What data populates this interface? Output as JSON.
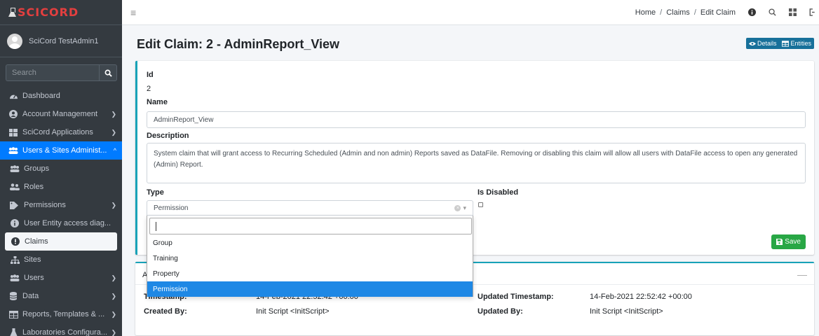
{
  "brand": {
    "name": "SCICORD"
  },
  "user": {
    "name": "SciCord TestAdmin1"
  },
  "sidebar": {
    "search_placeholder": "Search",
    "items": [
      {
        "label": "Dashboard"
      },
      {
        "label": "Account Management"
      },
      {
        "label": "SciCord Applications"
      },
      {
        "label": "Users & Sites Administ..."
      },
      {
        "label": "Groups"
      },
      {
        "label": "Roles"
      },
      {
        "label": "Permissions"
      },
      {
        "label": "User Entity access diag..."
      },
      {
        "label": "Claims"
      },
      {
        "label": "Sites"
      },
      {
        "label": "Users"
      },
      {
        "label": "Data"
      },
      {
        "label": "Reports, Templates & ..."
      },
      {
        "label": "Laboratories Configura..."
      }
    ]
  },
  "breadcrumb": {
    "home": "Home",
    "claims": "Claims",
    "current": "Edit Claim"
  },
  "page": {
    "title": "Edit Claim: 2 - AdminReport_View",
    "details_label": "Details",
    "entities_label": "Entities"
  },
  "form": {
    "id_label": "Id",
    "id_value": "2",
    "name_label": "Name",
    "name_value": "AdminReport_View",
    "description_label": "Description",
    "description_value": "System claim that will grant access to Recurring Scheduled (Admin and non admin) Reports saved as DataFile. Removing or disabling this claim will allow all users with DataFile access to open any generated (Admin) Report.",
    "type_label": "Type",
    "type_value": "Permission",
    "is_disabled_label": "Is Disabled",
    "is_disabled": false,
    "save_label": "Save"
  },
  "dropdown": {
    "options": [
      "Group",
      "Training",
      "Property",
      "Permission"
    ],
    "selected": "Permission"
  },
  "audit": {
    "created_timestamp_label": "Timestamp:",
    "created_timestamp_value": "14-Feb-2021 22:52:42 +00:00",
    "updated_timestamp_label": "Updated Timestamp:",
    "updated_timestamp_value": "14-Feb-2021 22:52:42 +00:00",
    "created_by_label": "Created By:",
    "created_by_value": "Init Script <InitScript>",
    "updated_by_label": "Updated By:",
    "updated_by_value": "Init Script <InitScript>"
  },
  "colors": {
    "brand_red": "#e43f3f",
    "sidebar_bg": "#343a40",
    "primary": "#007bff",
    "info": "#17a2b8",
    "success": "#28a745"
  }
}
